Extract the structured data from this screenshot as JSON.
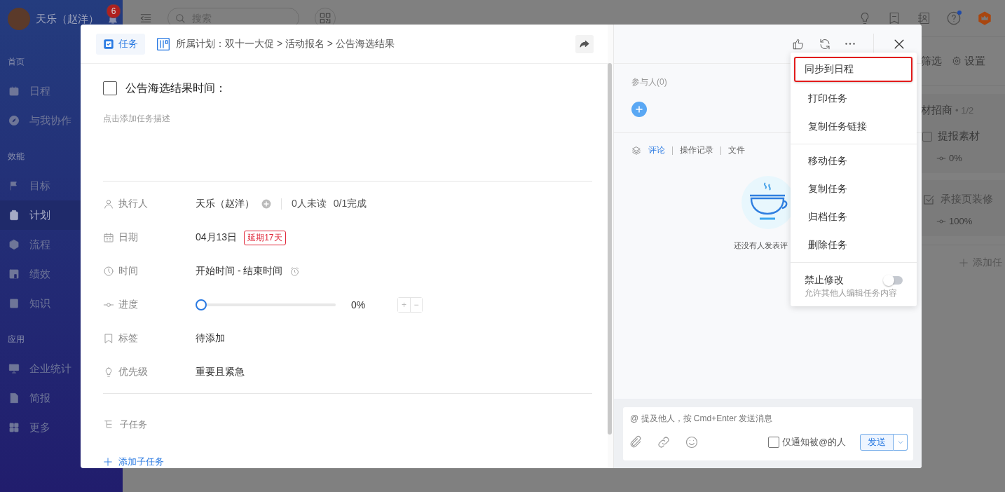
{
  "sidebar": {
    "user": {
      "name": "天乐（赵洋）",
      "notifications": "6"
    },
    "sections": [
      {
        "title": "首页",
        "items": [
          {
            "label": "日程",
            "kind": "calendar",
            "selected": false
          },
          {
            "label": "与我协作",
            "kind": "compass",
            "selected": false
          }
        ]
      },
      {
        "title": "效能",
        "items": [
          {
            "label": "目标",
            "kind": "flag",
            "selected": false
          },
          {
            "label": "计划",
            "kind": "clipboard",
            "selected": true
          },
          {
            "label": "流程",
            "kind": "cube",
            "selected": false
          },
          {
            "label": "绩效",
            "kind": "chart",
            "selected": false
          },
          {
            "label": "知识",
            "kind": "book",
            "selected": false
          }
        ]
      },
      {
        "title": "应用",
        "items": [
          {
            "label": "企业统计",
            "kind": "monitor",
            "selected": false
          },
          {
            "label": "简报",
            "kind": "doc",
            "selected": false
          },
          {
            "label": "更多",
            "kind": "grid",
            "selected": false
          }
        ]
      }
    ]
  },
  "topbar": {
    "search": {
      "placeholder": "搜索"
    },
    "help_unread": true
  },
  "board": {
    "filter": "筛选",
    "settings": "设置",
    "items": [
      {
        "kind": "group",
        "title": "材招商",
        "meta": "• 1/2"
      },
      {
        "kind": "subtask",
        "title": "提报素材",
        "checked": false,
        "progress": "0%"
      },
      {
        "kind": "task",
        "title": "承接页装修",
        "checked": true,
        "progress": "100%"
      }
    ],
    "add": "添加任"
  },
  "task": {
    "type_tag": "任务",
    "breadcrumb": "所属计划：双十一大促 > 活动报名 > 公告海选结果",
    "done": false,
    "title": "公告海选结果时间：",
    "description_placeholder": "点击添加任务描述",
    "fields": [
      {
        "kind": "assignee",
        "label": "执行人",
        "value": "天乐（赵洋）",
        "unread": "0人未读",
        "completion": "0/1完成"
      },
      {
        "kind": "date",
        "label": "日期",
        "value": "04月13日",
        "overdue": "延期17天"
      },
      {
        "kind": "time",
        "label": "时间",
        "value": "开始时间 - 结束时间"
      },
      {
        "kind": "progress",
        "label": "进度",
        "level": 0,
        "reading": "0%",
        "stepper": [
          "+",
          "−"
        ]
      },
      {
        "kind": "tags",
        "label": "标签",
        "value": "待添加"
      },
      {
        "kind": "priority",
        "label": "优先级",
        "value": "重要且紧急"
      }
    ],
    "subtasks": {
      "label": "子任务",
      "add": "添加子任务"
    }
  },
  "detail": {
    "participants": "参与人(0)",
    "tabs": [
      {
        "label": "评论",
        "selected": true
      },
      {
        "label": "操作记录",
        "selected": false
      },
      {
        "label": "文件",
        "selected": false
      }
    ],
    "empty_text": "还没有人发表评",
    "composer": {
      "placeholder": "@ 提及他人，按 Cmd+Enter 发送消息",
      "notify_only_mentioned": {
        "label": "仅通知被@的人",
        "checked": false
      },
      "send": "发送"
    }
  },
  "menu": {
    "groups": [
      {
        "items": [
          {
            "label": "同步到日程",
            "outlined": true
          },
          {
            "label": "打印任务",
            "outlined": false
          },
          {
            "label": "复制任务链接",
            "outlined": false
          }
        ]
      },
      {
        "items": [
          {
            "label": "移动任务",
            "outlined": false
          },
          {
            "label": "复制任务",
            "outlined": false
          },
          {
            "label": "归档任务",
            "outlined": false
          },
          {
            "label": "删除任务",
            "outlined": false
          }
        ]
      }
    ],
    "toggle": {
      "label": "禁止修改",
      "hint": "允许其他人编辑任务内容",
      "on": false
    }
  }
}
